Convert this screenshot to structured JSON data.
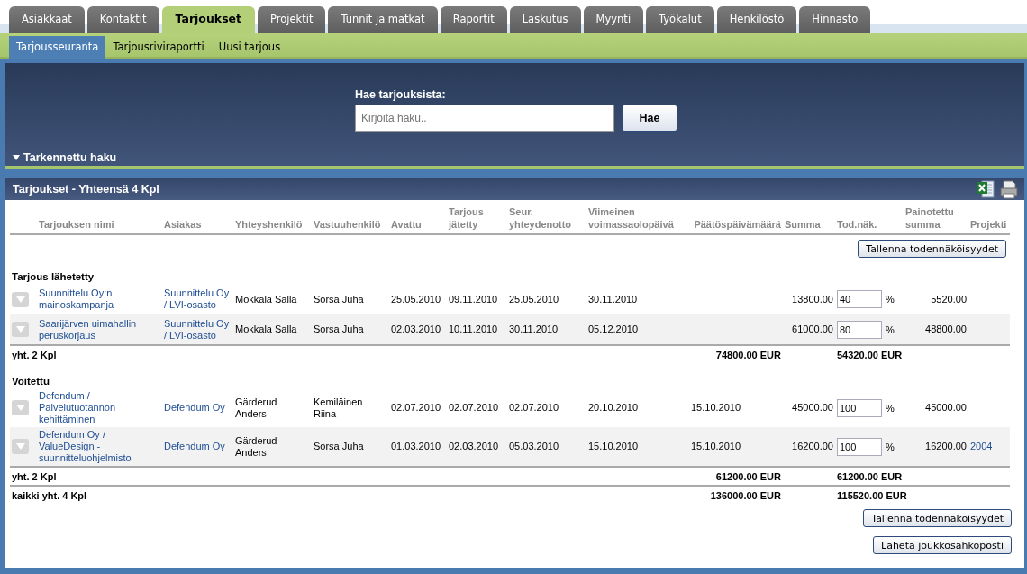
{
  "main_tabs": [
    {
      "label": "Asiakkaat",
      "selected": false
    },
    {
      "label": "Kontaktit",
      "selected": false
    },
    {
      "label": "Tarjoukset",
      "selected": true
    },
    {
      "label": "Projektit",
      "selected": false
    },
    {
      "label": "Tunnit ja matkat",
      "selected": false
    },
    {
      "label": "Raportit",
      "selected": false
    },
    {
      "label": "Laskutus",
      "selected": false
    },
    {
      "label": "Myynti",
      "selected": false
    },
    {
      "label": "Työkalut",
      "selected": false
    },
    {
      "label": "Henkilöstö",
      "selected": false
    },
    {
      "label": "Hinnasto",
      "selected": false
    }
  ],
  "sub_tabs": [
    {
      "label": "Tarjousseuranta",
      "selected": true
    },
    {
      "label": "Tarjousriviraportti",
      "selected": false
    },
    {
      "label": "Uusi tarjous",
      "selected": false
    }
  ],
  "search": {
    "label": "Hae tarjouksista:",
    "placeholder": "Kirjoita haku..",
    "button": "Hae",
    "advanced": "Tarkennettu haku"
  },
  "results": {
    "title": "Tarjoukset - Yhteensä 4 Kpl",
    "columns": [
      "Tarjouksen nimi",
      "Asiakas",
      "Yhteyshenkilö",
      "Vastuuhenkilö",
      "Avattu",
      "Tarjous jätetty",
      "Seur. yhteydenotto",
      "Viimeinen voimassaolopäivä",
      "Päätöspäivämäärä",
      "Summa",
      "Tod.näk.",
      "Painotettu summa",
      "Projekti"
    ],
    "save_button": "Tallenna todennäköisyydet",
    "groups": [
      {
        "title": "Tarjous lähetetty",
        "total_label": "yht. 2 Kpl",
        "total_sum": "74800.00 EUR",
        "total_weighted": "54320.00 EUR",
        "rows": [
          {
            "name": "Suunnittelu Oy:n mainoskampanja",
            "customer": "Suunnittelu Oy / LVI-osasto",
            "contact": "Mokkala Salla",
            "owner": "Sorsa Juha",
            "opened": "25.05.2010",
            "submitted": "09.11.2010",
            "next_contact": "25.05.2010",
            "valid_until": "30.11.2010",
            "sum": "13800.00",
            "probability": "40",
            "unit": "%",
            "weighted": "5520.00"
          },
          {
            "name": "Saarijärven uimahallin peruskorjaus",
            "customer": "Suunnittelu Oy / LVI-osasto",
            "contact": "Mokkala Salla",
            "owner": "Sorsa Juha",
            "opened": "02.03.2010",
            "submitted": "10.11.2010",
            "next_contact": "30.11.2010",
            "valid_until": "05.12.2010",
            "sum": "61000.00",
            "probability": "80",
            "unit": "%",
            "weighted": "48800.00"
          }
        ]
      },
      {
        "title": "Voitettu",
        "total_label": "yht. 2 Kpl",
        "total_sum": "61200.00 EUR",
        "total_weighted": "61200.00 EUR",
        "rows": [
          {
            "name": "Defendum / Palvelutuotannon kehittäminen",
            "customer": "Defendum Oy",
            "contact": "Gärderud Anders",
            "owner": "Kemiläinen Riina",
            "opened": "02.07.2010",
            "submitted": "02.07.2010",
            "next_contact": "02.07.2010",
            "valid_until": "20.10.2010",
            "decision_date": "15.10.2010",
            "sum": "45000.00",
            "probability": "100",
            "unit": "%",
            "weighted": "45000.00"
          },
          {
            "name": "Defendum Oy / ValueDesign -suunnitteluohjelmisto",
            "customer": "Defendum Oy",
            "contact": "Gärderud Anders",
            "owner": "Sorsa Juha",
            "opened": "01.03.2010",
            "submitted": "02.03.2010",
            "next_contact": "05.03.2010",
            "valid_until": "15.10.2010",
            "decision_date": "15.10.2010",
            "sum": "16200.00",
            "probability": "100",
            "unit": "%",
            "weighted": "16200.00",
            "project": "2004"
          }
        ]
      }
    ],
    "grand_total_label": "kaikki yht. 4 Kpl",
    "grand_total_sum": "136000.00 EUR",
    "grand_total_weighted": "115520.00 EUR",
    "save_button_bottom": "Tallenna todennäköisyydet",
    "mass_email_button": "Lähetä joukkosähköposti"
  }
}
